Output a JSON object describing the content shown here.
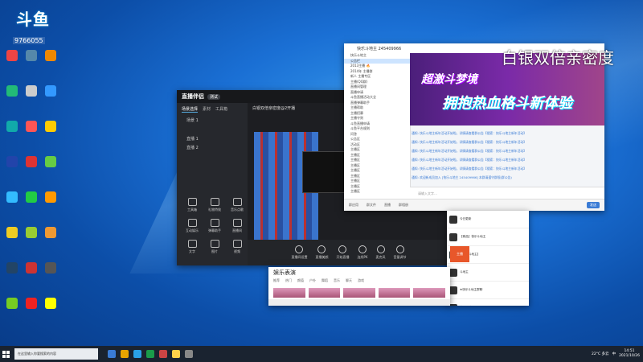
{
  "overlay": {
    "logo": "斗鱼",
    "room": "9766055"
  },
  "caption": "白银双倍亲密度",
  "desktop_icons": [
    {
      "name": "desktop-icon-1",
      "color": "#e44"
    },
    {
      "name": "desktop-icon-2",
      "color": "#58a"
    },
    {
      "name": "desktop-icon-3",
      "color": "#e80"
    },
    {
      "name": "desktop-icon-4",
      "color": "#2b7"
    },
    {
      "name": "desktop-icon-5",
      "color": "#ccc"
    },
    {
      "name": "desktop-icon-6",
      "color": "#39f"
    },
    {
      "name": "desktop-icon-7",
      "color": "#1aa"
    },
    {
      "name": "desktop-icon-8",
      "color": "#f55"
    },
    {
      "name": "desktop-icon-9",
      "color": "#fc0"
    },
    {
      "name": "desktop-icon-10",
      "color": "#24a"
    },
    {
      "name": "desktop-icon-11",
      "color": "#d33"
    },
    {
      "name": "desktop-icon-12",
      "color": "#6c4"
    },
    {
      "name": "desktop-icon-13",
      "color": "#3bf"
    },
    {
      "name": "desktop-icon-14",
      "color": "#2c4"
    },
    {
      "name": "desktop-icon-15",
      "color": "#f90"
    },
    {
      "name": "desktop-icon-16",
      "color": "#ec2"
    },
    {
      "name": "desktop-icon-17",
      "color": "#9c3"
    },
    {
      "name": "desktop-icon-18",
      "color": "#e93"
    },
    {
      "name": "desktop-icon-19",
      "color": "#246"
    },
    {
      "name": "desktop-icon-20",
      "color": "#c33"
    },
    {
      "name": "desktop-icon-21",
      "color": "#555"
    },
    {
      "name": "desktop-icon-22",
      "color": "#7c2"
    },
    {
      "name": "desktop-icon-23",
      "color": "#e22"
    },
    {
      "name": "desktop-icon-24",
      "color": "#ff0"
    }
  ],
  "stream": {
    "brand": "直播伴侣",
    "badge": "测试",
    "tabs": [
      "场景选择",
      "素材",
      "工具箱"
    ],
    "scenes": [
      "场景 1",
      "直播 1",
      "直播 2"
    ],
    "room_title": "白银双倍亲密度@2开播",
    "tools": [
      "工具箱",
      "礼物特效",
      "音乐点歌",
      "互动娱乐",
      "弹幕助手",
      "直播间",
      "文字",
      "图片",
      "视频"
    ],
    "bottom": [
      "直播间设置",
      "直播美颜",
      "开始直播",
      "连线PK",
      "麦克风",
      "音量调节"
    ]
  },
  "qq": {
    "title": "快乐斗地主 245409966",
    "tree": [
      "快乐斗地主",
      "公告栏",
      "2013主播 🔥",
      "2014年 主播群",
      "新人 主播专区",
      "主播(QQ群)",
      "直播间管理",
      "直播申请",
      "斗鱼直播活动大全",
      "直播弹幕助手",
      "主播帮助",
      "主播招募",
      "主播守则",
      "斗鱼直播申请",
      "斗鱼平台规则",
      "问答",
      "公告区",
      "活动区",
      "主播区",
      "主播区",
      "主播区",
      "主播区",
      "主播区",
      "主播区",
      "主播区",
      "主播区",
      "主播区"
    ],
    "banner_line1": "超激斗梦境",
    "banner_line2": "拥抱热血格斗新体验",
    "messages": [
      "通知: 快乐斗地主新年活动开始啦，详情请查看群公告【搜索：快乐斗地主新年活动】",
      "通知: 快乐斗地主新年活动开始啦，详情请查看群公告【搜索：快乐斗地主新年活动】",
      "通知: 快乐斗地主新年活动开始啦，详情请查看群公告【搜索：快乐斗地主新年活动】",
      "通知: 快乐斗地主新年活动开始啦，详情请查看群公告【搜索：快乐斗地主新年活动】",
      "通知: 快乐斗地主新年活动开始啦，详情请查看群公告【搜索：快乐斗地主新年活动】",
      "通知: 欢迎新成员加入 [快乐斗地主 245409966] 本群请遵守群规(群公告)"
    ],
    "input_placeholder": "请输入文字…",
    "send": "发送",
    "footer": [
      "群应用",
      "群文件",
      "直播",
      "群相册"
    ]
  },
  "side_list": [
    "今日更新",
    "【精品】快乐斗地主",
    "【快乐斗地主】",
    "斗地主",
    "★快乐斗地主群聊",
    "快乐斗地主"
  ],
  "yule": {
    "title": "娱乐表演",
    "nav": [
      "推荐",
      "热门",
      "颜值",
      "户外",
      "舞蹈",
      "音乐",
      "聊天",
      "游戏"
    ]
  },
  "red_tag": "主播",
  "taskbar": {
    "search_placeholder": "在这里输入你要搜索的内容",
    "apps": [
      "#3a7bd5",
      "#e8a400",
      "#2aa2e8",
      "#1a9c4a",
      "#c44",
      "#ffd24a",
      "#888"
    ],
    "weather": "22°C 多云",
    "lang": "中",
    "time": "14:51",
    "date": "2021/10/26"
  }
}
